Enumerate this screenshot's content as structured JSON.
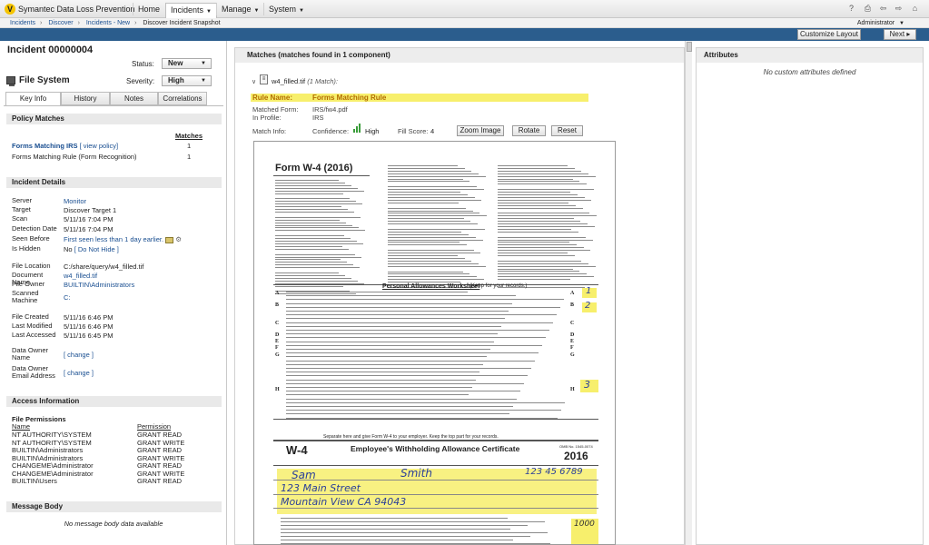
{
  "app": {
    "title": "Symantec Data Loss Prevention",
    "logo_letter": "V"
  },
  "nav": {
    "home": "Home",
    "incidents": "Incidents",
    "manage": "Manage",
    "system": "System"
  },
  "user": {
    "name": "Administrator"
  },
  "breadcrumb": [
    "Incidents",
    "Discover",
    "Incidents - New",
    "Discover Incident Snapshot"
  ],
  "actions": {
    "customize": "Customize Layout",
    "next": "Next"
  },
  "incident": {
    "title": "Incident 00000004",
    "status_label": "Status:",
    "status": "New",
    "severity_label": "Severity:",
    "severity": "High",
    "type": "File System"
  },
  "tabs": [
    "Key Info",
    "History",
    "Notes",
    "Correlations"
  ],
  "policy": {
    "heading": "Policy Matches",
    "matches_header": "Matches",
    "rows": [
      {
        "name": "Forms Matching IRS",
        "link": "[ view policy]",
        "count": "1"
      },
      {
        "name": "Forms Matching Rule (Form Recognition)",
        "link": "",
        "count": "1"
      }
    ]
  },
  "details": {
    "heading": "Incident Details",
    "server_label": "Server",
    "server": "Monitor",
    "target_label": "Target",
    "target": "Discover Target 1",
    "scan_label": "Scan",
    "scan": "5/11/16 7:04 PM",
    "detection_label": "Detection Date",
    "detection": "5/11/16 7:04 PM",
    "seen_label": "Seen Before",
    "seen": "First seen less than 1 day earlier.",
    "hidden_label": "Is Hidden",
    "hidden": "No",
    "hidden_link": "[ Do Not Hide ]",
    "location_label": "File Location",
    "location": "C:/share/query/w4_filled.tif",
    "docname_label": "Document Name",
    "docname": "w4_filled.tif",
    "owner_label": "File Owner",
    "owner": "BUILTIN\\Administrators",
    "scanned_label": "Scanned Machine",
    "scanned": "C:",
    "created_label": "File Created",
    "created": "5/11/16 6:46 PM",
    "modified_label": "Last Modified",
    "modified": "5/11/16 6:46 PM",
    "accessed_label": "Last Accessed",
    "accessed": "5/11/16 6:45 PM",
    "downer_label": "Data Owner Name",
    "downer": "[ change ]",
    "demail_label": "Data Owner Email Address",
    "demail": "[ change ]"
  },
  "access": {
    "heading": "Access Information",
    "sub": "File Permissions",
    "col_name": "Name",
    "col_perm": "Permission",
    "rows": [
      {
        "name": "NT AUTHORITY\\SYSTEM",
        "perm": "GRANT  READ"
      },
      {
        "name": "NT AUTHORITY\\SYSTEM",
        "perm": "GRANT  WRITE"
      },
      {
        "name": "BUILTIN\\Administrators",
        "perm": "GRANT  READ"
      },
      {
        "name": "BUILTIN\\Administrators",
        "perm": "GRANT  WRITE"
      },
      {
        "name": "CHANGEME\\Administrator",
        "perm": "GRANT  READ"
      },
      {
        "name": "CHANGEME\\Administrator",
        "perm": "GRANT  WRITE"
      },
      {
        "name": "BUILTIN\\Users",
        "perm": "GRANT  READ"
      }
    ]
  },
  "message": {
    "heading": "Message Body",
    "empty": "No message body data available"
  },
  "matches": {
    "heading": "Matches (matches found in 1 component)",
    "file": "w4_filled.tif",
    "file_count": "(1 Match):",
    "rule_label": "Rule Name:",
    "rule": "Forms Matching Rule",
    "form_label": "Matched Form:",
    "form": "IRS/fw4.pdf",
    "profile_label": "In Profile:",
    "profile": "IRS",
    "info_label": "Match Info:",
    "confidence_label": "Confidence:",
    "confidence": "High",
    "score_label": "Fill Score:",
    "score": "4",
    "zoom": "Zoom Image",
    "rotate": "Rotate",
    "reset": "Reset"
  },
  "form_image": {
    "title": "Form W-4 (2016)",
    "worksheet": "Personal Allowances Worksheet",
    "worksheet_note": "(Keep for your records.)",
    "lines": [
      "A",
      "B",
      "C",
      "D",
      "E",
      "F",
      "G",
      "H"
    ],
    "cut": "Separate here and give Form W-4 to your employer. Keep the top part for your records.",
    "cert_form": "W-4",
    "cert_title": "Employee's Withholding Allowance Certificate",
    "cert_year": "2016",
    "omb": "OMB No. 1545-0074",
    "hand_first": "Sam",
    "hand_last": "Smith",
    "hand_ssn": "123 45 6789",
    "hand_addr": "123 Main Street",
    "hand_city": "Mountain View CA 94043",
    "hand_a": "1",
    "hand_b": "2",
    "hand_h": "3",
    "hand_amount": "1000"
  },
  "attributes": {
    "heading": "Attributes",
    "empty": "No custom attributes defined"
  }
}
